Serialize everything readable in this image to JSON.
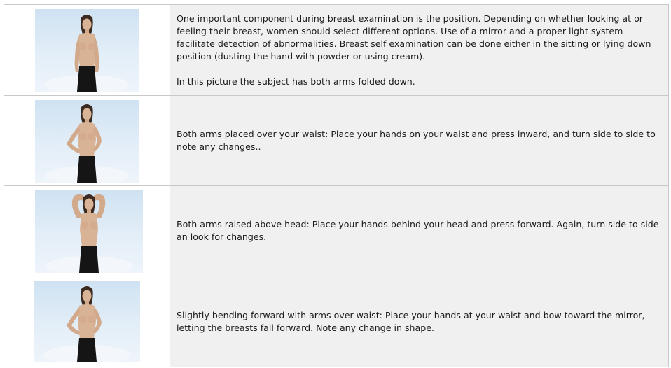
{
  "rows": [
    {
      "figure": "woman-arms-down",
      "paragraphs": [
        "One important component during breast examination is the position. Depending on whether looking at or feeling their breast, women should select different options. Use of a mirror and a proper light system facilitate detection of abnormalities. Breast self examination can be done either in the sitting or lying down position (dusting the hand with powder or using cream).",
        "In this picture the subject has both arms folded down."
      ]
    },
    {
      "figure": "woman-hands-on-waist",
      "paragraphs": [
        "Both arms placed over your waist: Place your hands on your waist and press inward, and turn side to side to note any changes.."
      ]
    },
    {
      "figure": "woman-arms-raised",
      "paragraphs": [
        "Both arms raised above head: Place your hands behind your head and press forward. Again, turn side to side an look for changes."
      ]
    },
    {
      "figure": "woman-bending-forward",
      "paragraphs": [
        "Slightly bending forward with arms over waist: Place your hands at your waist and bow toward the mirror, letting the breasts fall forward. Note any change in shape."
      ]
    }
  ]
}
